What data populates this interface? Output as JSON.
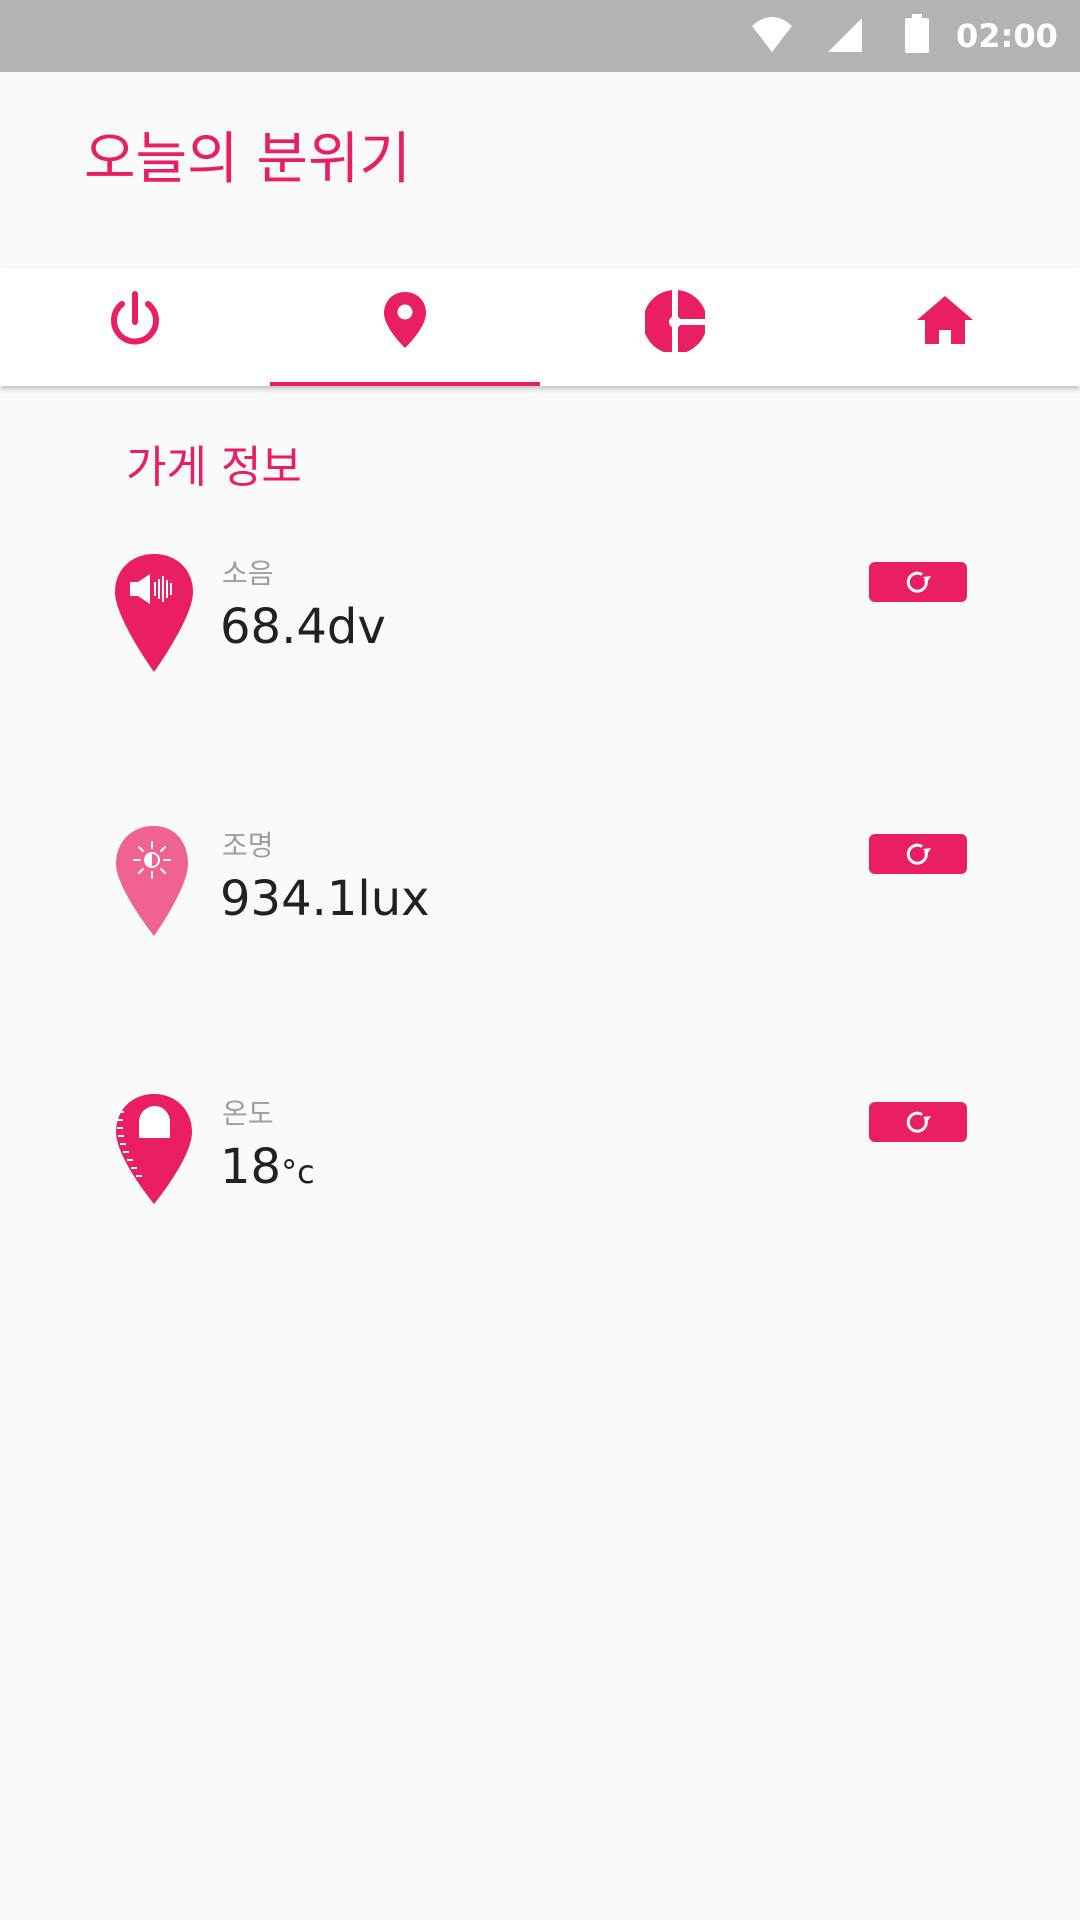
{
  "status_bar": {
    "time": "02:00",
    "icons": [
      "wifi-icon",
      "cell-signal-icon",
      "battery-icon"
    ]
  },
  "app_bar": {
    "title": "오늘의 분위기"
  },
  "tabs": [
    {
      "icon": "power-icon",
      "selected": false
    },
    {
      "icon": "location-pin-icon",
      "selected": true
    },
    {
      "icon": "pie-chart-icon",
      "selected": false
    },
    {
      "icon": "home-icon",
      "selected": false
    }
  ],
  "section": {
    "title": "가게 정보"
  },
  "metrics": [
    {
      "label": "소음",
      "value": "68.4dv",
      "icon": "noise-speaker-pin-icon",
      "action_icon": "refresh-icon"
    },
    {
      "label": "조명",
      "value": "934.1lux",
      "icon": "light-brightness-pin-icon",
      "action_icon": "refresh-icon"
    },
    {
      "label": "온도",
      "value_number": "18",
      "value_unit": "°c",
      "icon": "temperature-thermometer-pin-icon",
      "action_icon": "refresh-icon"
    }
  ],
  "colors": {
    "accent": "#e91e63",
    "accent_light": "#f06292",
    "status_bar": "#b3b3b3",
    "background": "#fafafa",
    "label_gray": "#9e9e9e",
    "value_text": "#212121"
  }
}
